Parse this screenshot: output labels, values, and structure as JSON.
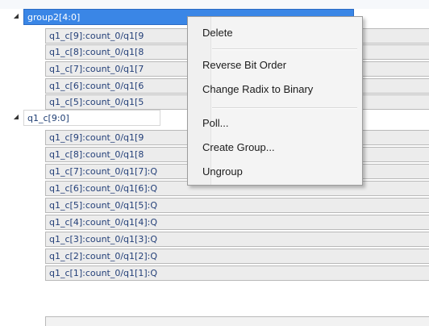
{
  "icons": {
    "expanded": "triangle-down-right-icon"
  },
  "colors": {
    "selection": "#3a86e6",
    "row_fill": "#ececec",
    "text": "#1e3d73"
  },
  "tree": {
    "group2": {
      "label": "group2[4:0]",
      "children": [
        "q1_c[9]:count_0/q1[9",
        "q1_c[8]:count_0/q1[8",
        "q1_c[7]:count_0/q1[7",
        "q1_c[6]:count_0/q1[6",
        "q1_c[5]:count_0/q1[5"
      ]
    },
    "q1c": {
      "label": "q1_c[9:0]",
      "children": [
        "q1_c[9]:count_0/q1[9",
        "q1_c[8]:count_0/q1[8",
        "q1_c[7]:count_0/q1[7]:Q",
        "q1_c[6]:count_0/q1[6]:Q",
        "q1_c[5]:count_0/q1[5]:Q",
        "q1_c[4]:count_0/q1[4]:Q",
        "q1_c[3]:count_0/q1[3]:Q",
        "q1_c[2]:count_0/q1[2]:Q",
        "q1_c[1]:count_0/q1[1]:Q"
      ]
    }
  },
  "context_menu": {
    "items": [
      "Delete",
      "Reverse Bit Order",
      "Change Radix to Binary",
      "Poll...",
      "Create Group...",
      "Ungroup"
    ]
  }
}
